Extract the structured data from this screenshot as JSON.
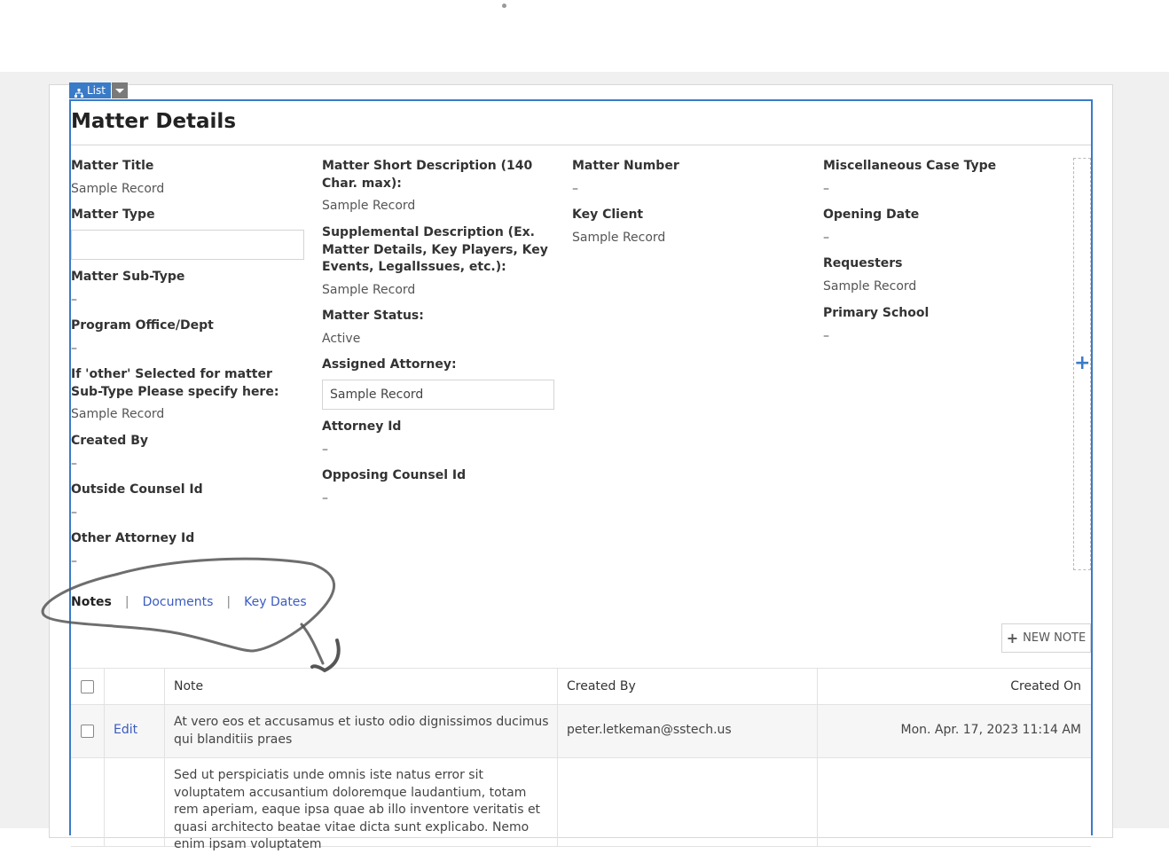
{
  "list_badge": {
    "label": "List"
  },
  "page": {
    "title": "Matter Details"
  },
  "columns": {
    "col1": [
      {
        "label": "Matter Title",
        "value": "Sample Record"
      },
      {
        "label": "Matter Type",
        "value": ""
      },
      {
        "label": "Matter Sub-Type",
        "value": "–"
      },
      {
        "label": "Program Office/Dept",
        "value": "–"
      },
      {
        "label": "If 'other' Selected for matter Sub-Type Please specify here:",
        "value": "Sample Record"
      },
      {
        "label": "Created By",
        "value": "–"
      },
      {
        "label": "Outside Counsel Id",
        "value": "–"
      },
      {
        "label": "Other Attorney Id",
        "value": "–"
      }
    ],
    "col2": [
      {
        "label": "Matter Short Description (140 Char. max):",
        "value": "Sample Record"
      },
      {
        "label": "Supplemental Description (Ex. Matter Details, Key Players, Key Events, LegalIssues, etc.):",
        "value": "Sample Record"
      },
      {
        "label": "Matter Status:",
        "value": "Active"
      },
      {
        "label": "Assigned Attorney:",
        "value": "Sample Record"
      },
      {
        "label": "Attorney Id",
        "value": "–"
      },
      {
        "label": "Opposing Counsel Id",
        "value": "–"
      }
    ],
    "col3": [
      {
        "label": "Matter Number",
        "value": "–"
      },
      {
        "label": "Key Client",
        "value": "Sample Record"
      }
    ],
    "col4": [
      {
        "label": "Miscellaneous Case Type",
        "value": "–"
      },
      {
        "label": "Opening Date",
        "value": "–"
      },
      {
        "label": "Requesters",
        "value": "Sample Record"
      },
      {
        "label": "Primary School",
        "value": "–"
      }
    ]
  },
  "tabs": {
    "active": "Notes",
    "items": [
      "Documents",
      "Key Dates"
    ],
    "separator": "|"
  },
  "new_note_button": {
    "label": "NEW NOTE"
  },
  "notes_table": {
    "headers": {
      "note": "Note",
      "created_by": "Created By",
      "created_on": "Created On"
    },
    "rows": [
      {
        "edit_label": "Edit",
        "note": "At vero eos et accusamus et iusto odio dignissimos ducimus qui blanditiis praes",
        "created_by": "peter.letkeman@sstech.us",
        "created_on": "Mon. Apr. 17, 2023 11:14 AM"
      },
      {
        "edit_label": "",
        "note": "Sed ut perspiciatis unde omnis iste natus error sit voluptatem accusantium doloremque laudantium, totam rem aperiam, eaque ipsa quae ab illo inventore veritatis et quasi architecto beatae vitae dicta sunt explicabo. Nemo enim ipsam voluptatem",
        "created_by": "",
        "created_on": ""
      }
    ]
  },
  "colors": {
    "accent": "#3a7bc8",
    "link": "#3a5bbf",
    "border": "#d4d4d4"
  },
  "icons": [
    "sitemap-icon",
    "caret-down-icon",
    "plus-icon",
    "plus-icon",
    "checkbox-icon"
  ]
}
